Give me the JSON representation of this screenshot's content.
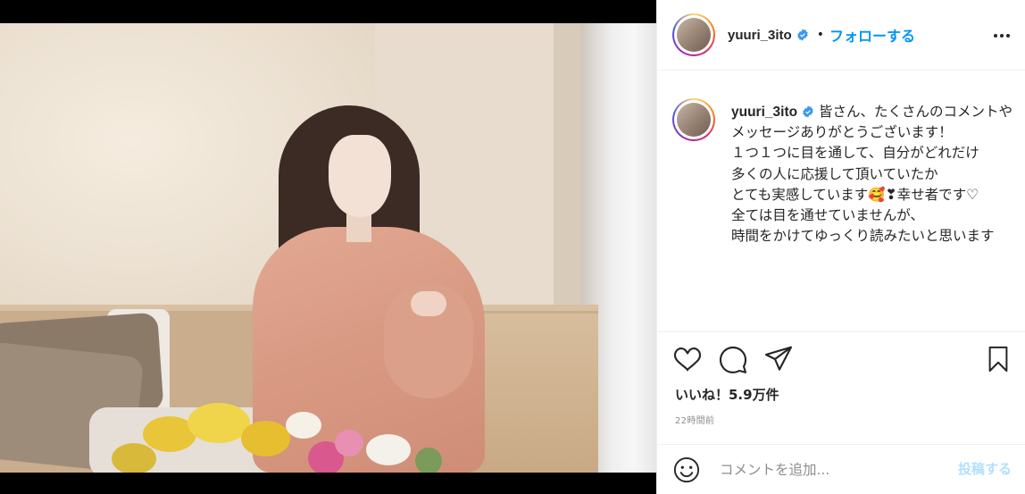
{
  "post": {
    "username": "yuuri_3ito",
    "separator": "•",
    "follow_label": "フォローする",
    "caption_lines": "皆さん、たくさんのコメントや\nメッセージありがとうございます！\n１つ１つに目を通して、自分がどれだけ\n多くの人に応援して頂いていたか\nとても実感しています🥰❣幸せ者です♡\n全ては目を通せていませんが、\n時間をかけてゆっくり読みたいと思います",
    "likes": "いいね！5.9万件",
    "time": "22時間前"
  },
  "comment": {
    "placeholder": "コメントを追加...",
    "post_label": "投稿する"
  },
  "icons": {
    "verified": "verified-badge-icon",
    "more": "more-options-icon",
    "like": "heart-icon",
    "comment": "comment-bubble-icon",
    "share": "paper-plane-icon",
    "save": "bookmark-icon",
    "emoji": "emoji-smile-icon"
  },
  "colors": {
    "accent": "#0095f6",
    "verified": "#3897f0",
    "post_disabled": "#b2dffc",
    "muted": "#8e8e8e"
  }
}
